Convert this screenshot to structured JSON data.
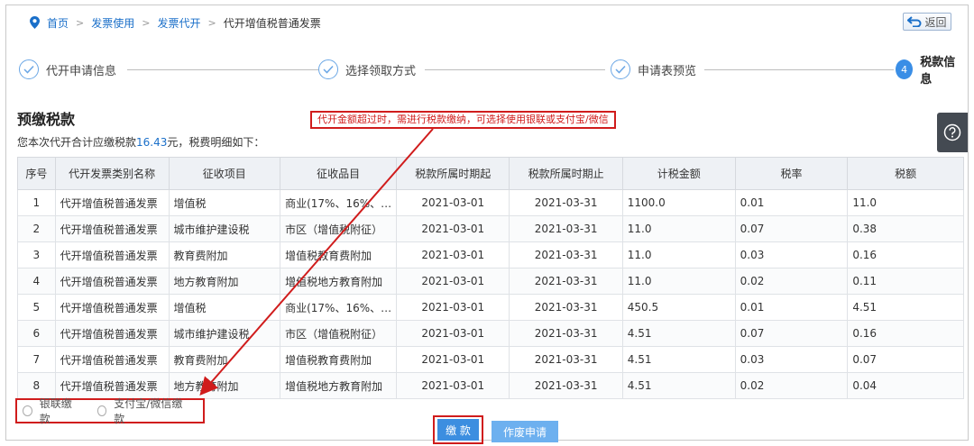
{
  "breadcrumb": {
    "items": [
      "首页",
      "发票使用",
      "发票代开"
    ],
    "current": "代开增值税普通发票",
    "separator": ">"
  },
  "back_button": "返回",
  "steps": [
    {
      "label": "代开申请信息",
      "state": "done"
    },
    {
      "label": "选择领取方式",
      "state": "done"
    },
    {
      "label": "申请表预览",
      "state": "done"
    },
    {
      "label": "税款信息",
      "state": "active",
      "number": "4"
    }
  ],
  "section_title": "预缴税款",
  "summary": {
    "prefix": "您本次代开合计应缴税款",
    "amount": "16.43",
    "suffix": "元，税费明细如下："
  },
  "callout": "代开金额超过时，需进行税款缴纳，可选择使用银联或支付宝/微信",
  "table": {
    "headers": [
      "序号",
      "代开发票类别名称",
      "征收项目",
      "征收品目",
      "税款所属时期起",
      "税款所属时期止",
      "计税金额",
      "税率",
      "税额"
    ],
    "rows": [
      [
        "1",
        "代开增值税普通发票",
        "增值税",
        "商业(17%、16%、…",
        "2021-03-01",
        "2021-03-31",
        "1100.0",
        "0.01",
        "11.0"
      ],
      [
        "2",
        "代开增值税普通发票",
        "城市维护建设税",
        "市区（增值税附征）",
        "2021-03-01",
        "2021-03-31",
        "11.0",
        "0.07",
        "0.38"
      ],
      [
        "3",
        "代开增值税普通发票",
        "教育费附加",
        "增值税教育费附加",
        "2021-03-01",
        "2021-03-31",
        "11.0",
        "0.03",
        "0.16"
      ],
      [
        "4",
        "代开增值税普通发票",
        "地方教育附加",
        "增值税地方教育附加",
        "2021-03-01",
        "2021-03-31",
        "11.0",
        "0.02",
        "0.11"
      ],
      [
        "5",
        "代开增值税普通发票",
        "增值税",
        "商业(17%、16%、…",
        "2021-03-01",
        "2021-03-31",
        "450.5",
        "0.01",
        "4.51"
      ],
      [
        "6",
        "代开增值税普通发票",
        "城市维护建设税",
        "市区（增值税附征）",
        "2021-03-01",
        "2021-03-31",
        "4.51",
        "0.07",
        "0.16"
      ],
      [
        "7",
        "代开增值税普通发票",
        "教育费附加",
        "增值税教育费附加",
        "2021-03-01",
        "2021-03-31",
        "4.51",
        "0.03",
        "0.07"
      ],
      [
        "8",
        "代开增值税普通发票",
        "地方教育附加",
        "增值税地方教育附加",
        "2021-03-01",
        "2021-03-31",
        "4.51",
        "0.02",
        "0.04"
      ]
    ]
  },
  "payment_options": [
    "银联缴款",
    "支付宝/微信缴款"
  ],
  "buttons": {
    "pay": "缴 款",
    "void": "作废申请"
  },
  "icons": {
    "location": "location-pin-icon",
    "back": "return-arrow-icon",
    "help": "question-circle-icon",
    "step_done": "check-circle-icon"
  },
  "colors": {
    "accent": "#3a8ee6",
    "link": "#1a6fc9",
    "annotation": "#d01c1c"
  }
}
